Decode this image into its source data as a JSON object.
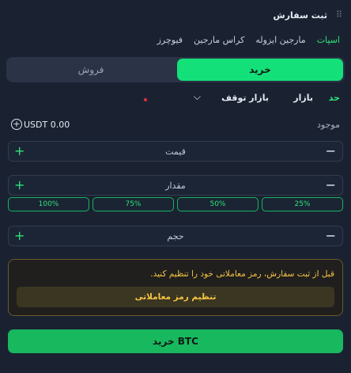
{
  "panel": {
    "title": "ثبت سفارش",
    "drag_icon": "grip-icon"
  },
  "margin_tabs": [
    {
      "label": "اسپات",
      "active": true
    },
    {
      "label": "مارجین ایزوله",
      "active": false
    },
    {
      "label": "کراس مارجین",
      "active": false
    },
    {
      "label": "فیوچرز",
      "active": false
    }
  ],
  "side_tabs": {
    "buy": "خرید",
    "sell": "فروش",
    "active": "buy"
  },
  "order_types": {
    "limit": "حد",
    "market": "بازار",
    "stop_market": "بازار توقف"
  },
  "balance": {
    "label": "موجود",
    "value": "USDT 0.00"
  },
  "fields": {
    "price": "قیمت",
    "amount": "مقدار",
    "total": "حجم"
  },
  "percent_buttons": [
    "25%",
    "50%",
    "75%",
    "100%"
  ],
  "notice": {
    "text": "قبل از ثبت سفارش، رمز معاملاتی خود را تنظیم کنید.",
    "button": "تنظیم رمز معاملاتی"
  },
  "submit": {
    "label": "خرید BTC"
  },
  "colors": {
    "accent": "#14e079",
    "warning": "#f5c542",
    "background": "#1a2232"
  }
}
